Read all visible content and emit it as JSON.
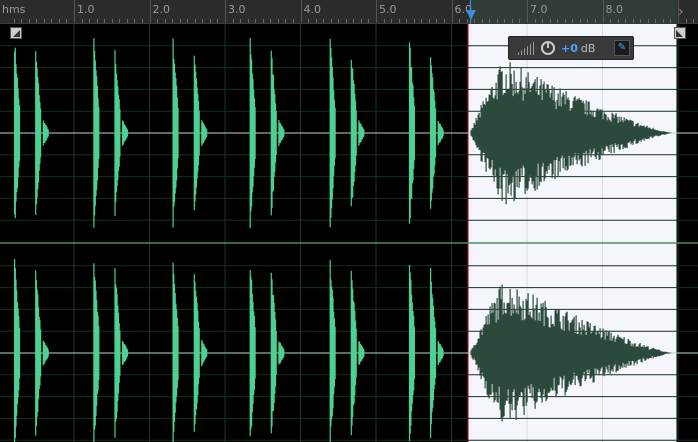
{
  "ruler": {
    "unit_label": "hms",
    "labels": [
      "1.0",
      "2.0",
      "3.0",
      "4.0",
      "5.0",
      "6.0",
      "7.0",
      "8.0"
    ]
  },
  "selection": {
    "start_s": 6.22,
    "end_s": 8.98
  },
  "hud": {
    "gain_value": "+0",
    "gain_unit": "dB",
    "pin_icon": "pin-icon"
  },
  "colors": {
    "waveform": "#4cd193",
    "waveform_selected": "#2c4a3b",
    "selection_bg": "#f5f6fb",
    "background": "#000000",
    "playhead": "#3a8fe0"
  },
  "channels": [
    "left",
    "right"
  ]
}
